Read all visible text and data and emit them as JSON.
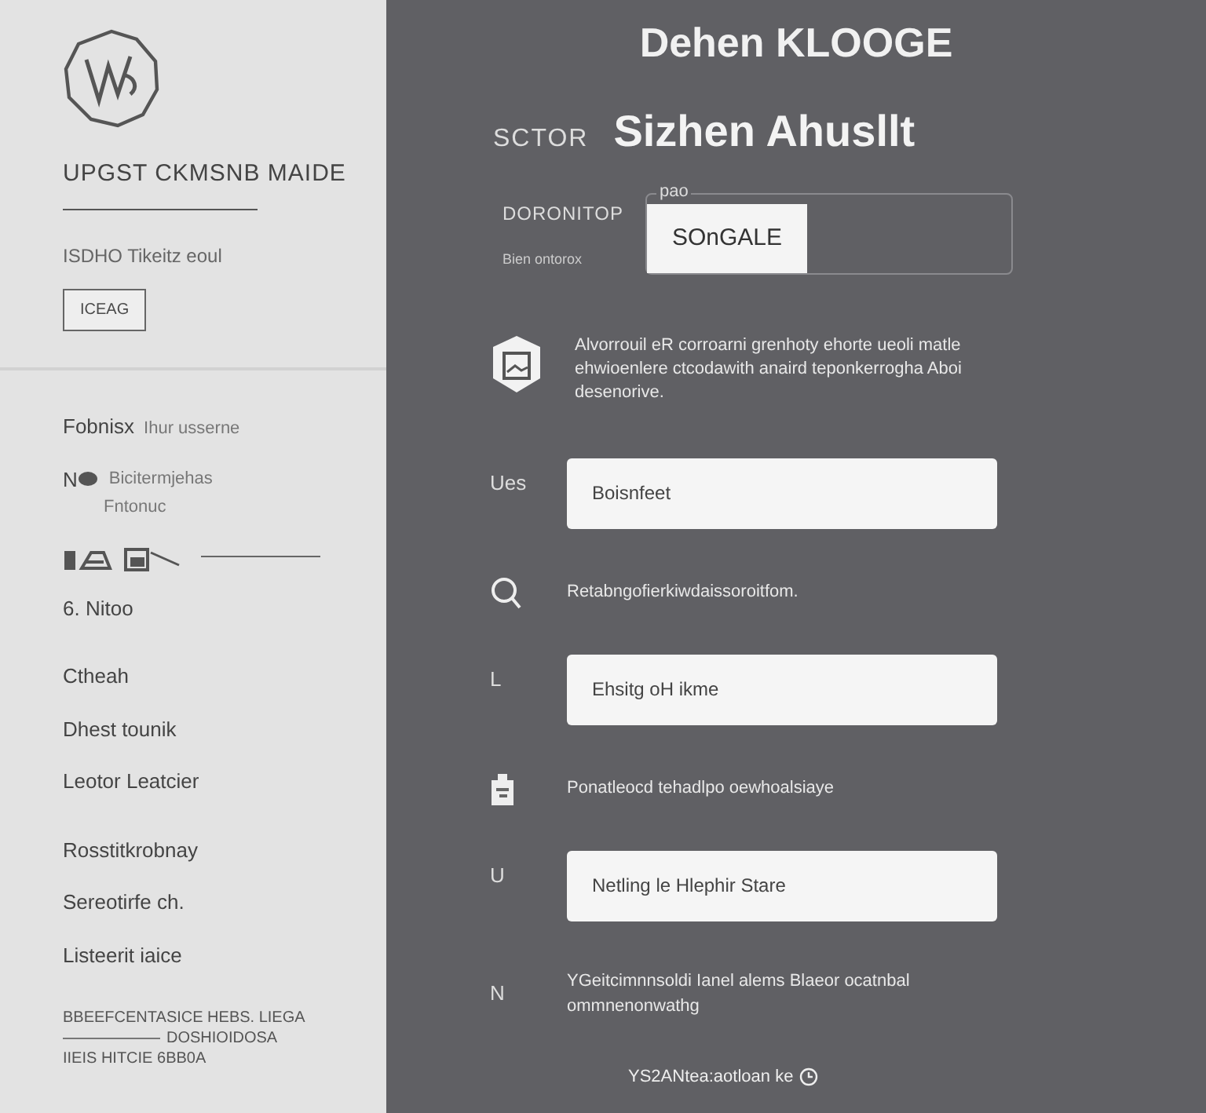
{
  "sidebar": {
    "title": "UPGST CKMSNB MAIDE",
    "subtitle": "ISDHO Tikeitz eoul",
    "tag": "ICEAG",
    "groups": [
      {
        "items": [
          {
            "kind": "pair",
            "label": "Fobnisx",
            "detail": "Ihur usserne"
          },
          {
            "kind": "icon-pair",
            "label": "N",
            "detail": "Bicitermjehas",
            "sub": "Fntonuc"
          },
          {
            "kind": "sketch"
          },
          {
            "kind": "text",
            "label": "6. Nitoo"
          }
        ]
      },
      {
        "items": [
          {
            "kind": "text",
            "label": "Ctheah"
          },
          {
            "kind": "text",
            "label": "Dhest tounik"
          },
          {
            "kind": "text",
            "label": "Leotor  Leatcier"
          }
        ]
      },
      {
        "items": [
          {
            "kind": "text",
            "label": "Rosstitkrobnay"
          },
          {
            "kind": "text",
            "label": "Sereotirfe ch."
          },
          {
            "kind": "text",
            "label": "Listeerit iaice"
          }
        ]
      }
    ],
    "footer": [
      "BBEEFCENTASICE HEBS. LIEGA",
      "DOSHIOIDOSA",
      "IIEIS HITCIE 6BB0A"
    ]
  },
  "main": {
    "title": "Dehen KLOOGE",
    "heading_label": "SCTOR",
    "heading": "Sizhen Ahusllt",
    "picker": {
      "label": "DORONITOP",
      "sublabel": "Bien ontorox",
      "legend": "pao",
      "button": "SOnGALE"
    },
    "info": "Alvorrouil eR corroarni grenhoty ehorte ueoli matle ehwioenlere ctcodawith anaird teponkerrogha Aboi desenorive.",
    "rows": [
      {
        "kind": "field",
        "label": "Ues",
        "value": "Boisnfeet"
      },
      {
        "kind": "search",
        "text": "Retabngofierkiwdaissoroitfom."
      },
      {
        "kind": "field",
        "label": "L",
        "value": "Ehsitg oH ikme"
      },
      {
        "kind": "clipboard",
        "text": "Ponatleocd tehadlpo oewhoalsiaye"
      },
      {
        "kind": "field",
        "label": "U",
        "value": "Netling le Hlephir Stare"
      },
      {
        "kind": "labeled",
        "label": "N",
        "text": "YGeitcimnnsoldi Ianel alems Blaeor ocatnbal ommnenonwathg"
      }
    ],
    "footer": "YS2ANtea:aotloan ke"
  }
}
